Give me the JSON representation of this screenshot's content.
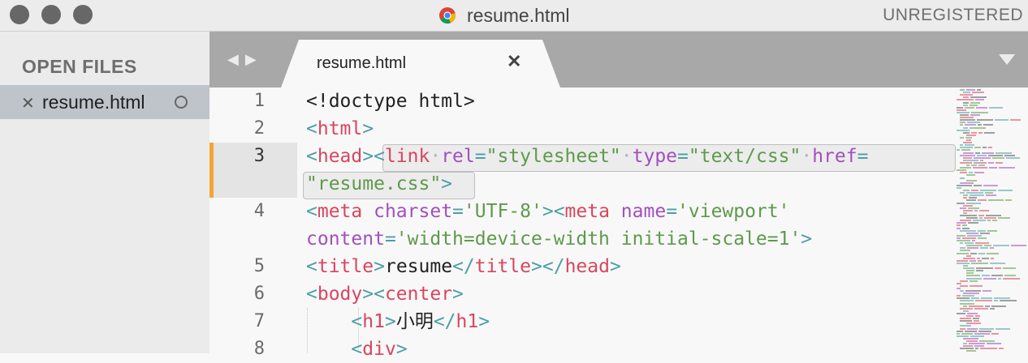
{
  "window": {
    "title": "resume.html",
    "license_status": "UNREGISTERED",
    "title_icon": "chrome-icon"
  },
  "sidebar": {
    "heading": "OPEN FILES",
    "files": [
      {
        "label": "resume.html",
        "close_glyph": "✕",
        "dirty": true
      }
    ]
  },
  "tabs": {
    "nav_back": "◀",
    "nav_forward": "▶",
    "items": [
      {
        "label": "resume.html",
        "close_glyph": "✕",
        "active": true
      }
    ]
  },
  "editor": {
    "active_line": "3",
    "line_numbers": [
      "1",
      "2",
      "3",
      "",
      "4",
      "",
      "5",
      "6",
      "7",
      "8"
    ],
    "colors": {
      "punctuation": "#4c9ea6",
      "tag": "#d8465f",
      "attribute": "#a24fbf",
      "string": "#5e9a4b",
      "text": "#222222",
      "modified_marker": "#f6a434"
    }
  }
}
